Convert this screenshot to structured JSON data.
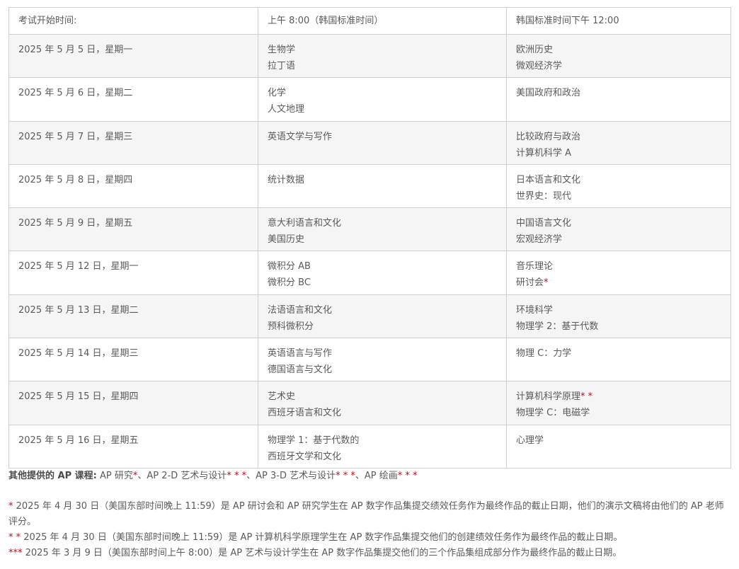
{
  "table": {
    "headers": [
      "考试开始时间:",
      "上午 8:00（韩国标准时间）",
      "韩国标准时间下午 12:00"
    ],
    "rows": [
      {
        "date": "2025 年 5 月 5 日，星期一",
        "am": [
          {
            "text": "生物学",
            "mark": ""
          },
          {
            "text": "拉丁语",
            "mark": ""
          }
        ],
        "pm": [
          {
            "text": "欧洲历史",
            "mark": ""
          },
          {
            "text": "微观经济学",
            "mark": ""
          }
        ]
      },
      {
        "date": "2025 年 5 月 6 日，星期二",
        "am": [
          {
            "text": "化学",
            "mark": ""
          },
          {
            "text": "人文地理",
            "mark": ""
          }
        ],
        "pm": [
          {
            "text": "美国政府和政治",
            "mark": ""
          }
        ]
      },
      {
        "date": "2025 年 5 月 7 日，星期三",
        "am": [
          {
            "text": "英语文学与写作",
            "mark": ""
          }
        ],
        "pm": [
          {
            "text": "比较政府与政治",
            "mark": ""
          },
          {
            "text": "计算机科学 A",
            "mark": ""
          }
        ]
      },
      {
        "date": "2025 年 5 月 8 日，星期四",
        "am": [
          {
            "text": "统计数据",
            "mark": ""
          }
        ],
        "pm": [
          {
            "text": "日本语言和文化",
            "mark": ""
          },
          {
            "text": "世界史：现代",
            "mark": ""
          }
        ]
      },
      {
        "date": "2025 年 5 月 9 日，星期五",
        "am": [
          {
            "text": "意大利语言和文化",
            "mark": ""
          },
          {
            "text": "美国历史",
            "mark": ""
          }
        ],
        "pm": [
          {
            "text": "中国语言文化",
            "mark": ""
          },
          {
            "text": "宏观经济学",
            "mark": ""
          }
        ]
      },
      {
        "date": "2025 年 5 月 12 日，星期一",
        "am": [
          {
            "text": "微积分 AB",
            "mark": ""
          },
          {
            "text": "微积分 BC",
            "mark": ""
          }
        ],
        "pm": [
          {
            "text": "音乐理论",
            "mark": ""
          },
          {
            "text": "研讨会",
            "mark": "*"
          }
        ]
      },
      {
        "date": "2025 年 5 月 13 日，星期二",
        "am": [
          {
            "text": "法语语言和文化",
            "mark": ""
          },
          {
            "text": "预科微积分",
            "mark": ""
          }
        ],
        "pm": [
          {
            "text": "环境科学",
            "mark": ""
          },
          {
            "text": "物理学 2：基于代数",
            "mark": ""
          }
        ]
      },
      {
        "date": "2025 年 5 月 14 日，星期三",
        "am": [
          {
            "text": "英语语言与写作",
            "mark": ""
          },
          {
            "text": "德国语言与文化",
            "mark": ""
          }
        ],
        "pm": [
          {
            "text": "物理 C：力学",
            "mark": ""
          }
        ]
      },
      {
        "date": "2025 年 5 月 15 日，星期四",
        "am": [
          {
            "text": "艺术史",
            "mark": ""
          },
          {
            "text": "西班牙语言和文化",
            "mark": ""
          }
        ],
        "pm": [
          {
            "text": "计算机科学原理",
            "mark": "* *"
          },
          {
            "text": "物理学 C：电磁学",
            "mark": ""
          }
        ]
      },
      {
        "date": "2025 年 5 月 16 日，星期五",
        "am": [
          {
            "text": "物理学 1：基于代数的",
            "mark": ""
          },
          {
            "text": "西班牙文学和文化",
            "mark": ""
          }
        ],
        "pm": [
          {
            "text": "心理学",
            "mark": ""
          }
        ]
      }
    ]
  },
  "other_courses": {
    "lead": "其他提供的 AP 课程:",
    "items": [
      {
        "text": "AP 研究",
        "mark": "*",
        "sep": "、"
      },
      {
        "text": "AP 2-D 艺术与设计",
        "mark": "* * *",
        "sep": "、"
      },
      {
        "text": "AP 3-D 艺术与设计",
        "mark": "* * *",
        "sep": "、"
      },
      {
        "text": "AP 绘画",
        "mark": "* * *",
        "sep": ""
      }
    ]
  },
  "notes": [
    {
      "mark": "*",
      "text": " 2025 年 4 月 30 日（美国东部时间晚上 11:59）是 AP 研讨会和 AP 研究学生在 AP 数字作品集提交绩效任务作为最终作品的截止日期，他们的演示文稿将由他们的 AP 老师评分。"
    },
    {
      "mark": "* *",
      "text": " 2025 年 4 月 30 日（美国东部时间晚上 11:59）是 AP 计算机科学原理学生在 AP 数字作品集提交他们的创建绩效任务作为最终作品的截止日期。"
    },
    {
      "mark": "***",
      "text": " 2025 年 3 月 9 日（美国东部时间上午 8:00）是 AP 艺术与设计学生在 AP 数字作品集提交他们的三个作品集组成部分作为最终作品的截止日期。"
    }
  ],
  "colors": {
    "text": "#5a5a5a",
    "border": "#cfcfcf",
    "alt_row": "#f5f5f5",
    "asterisk": "#d0021b"
  }
}
